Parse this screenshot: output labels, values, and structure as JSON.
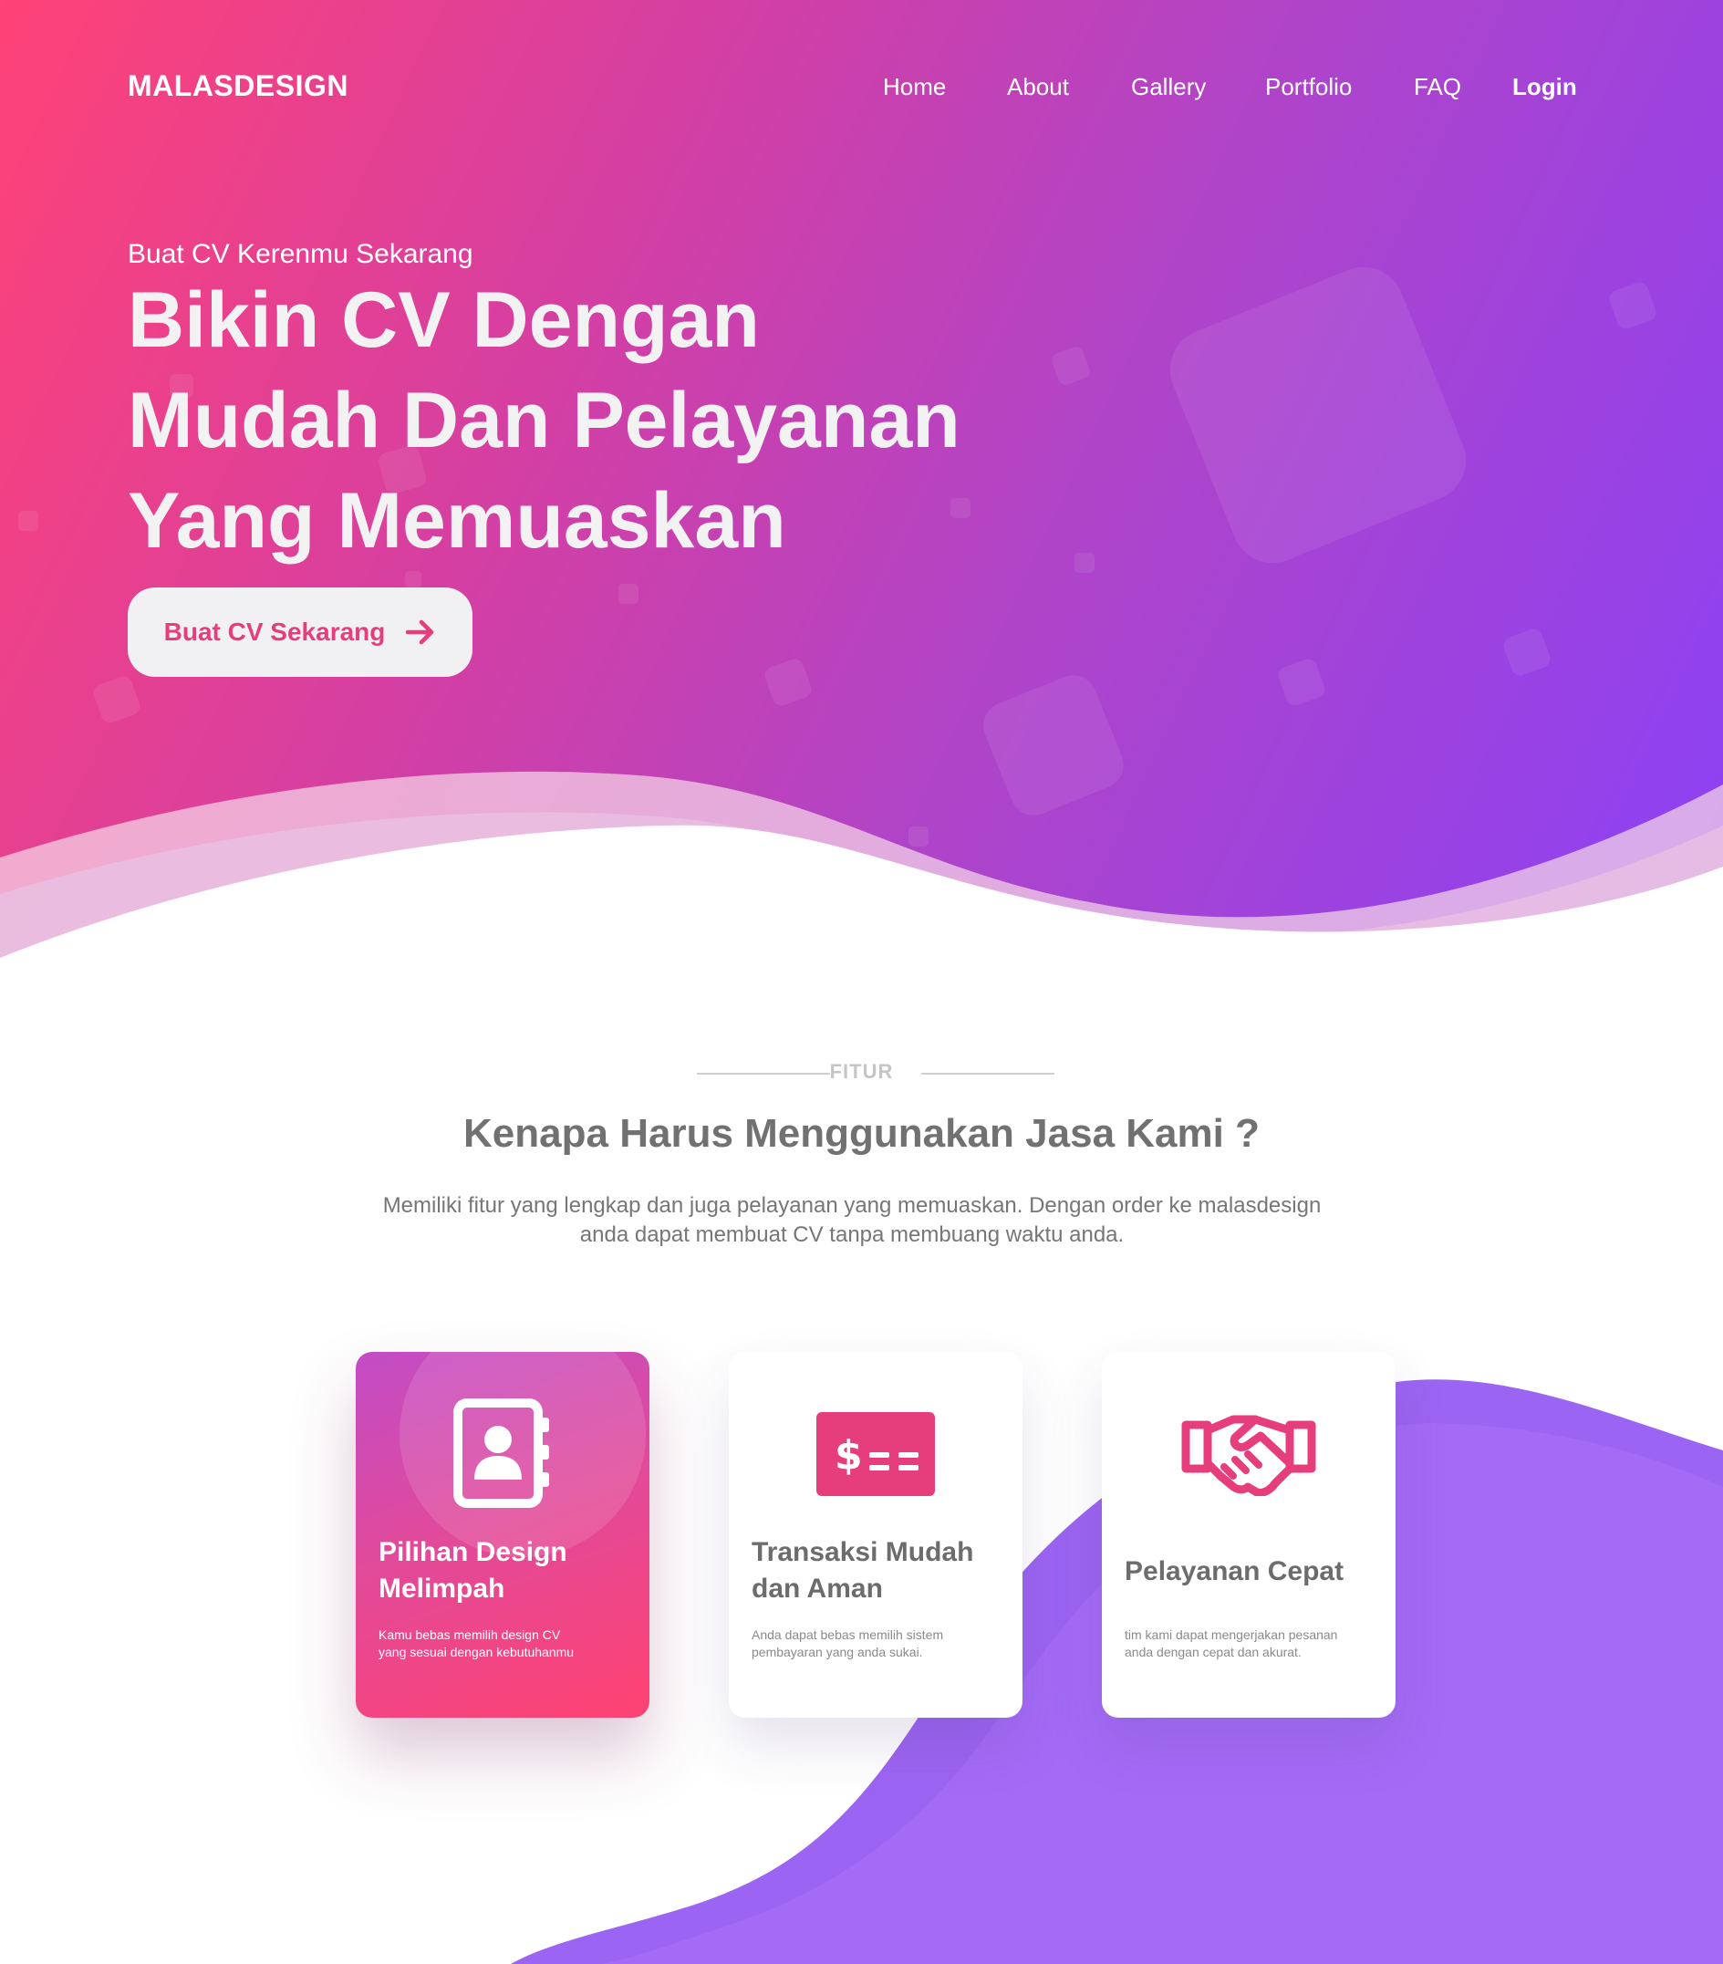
{
  "header": {
    "brand": "MALASDESIGN",
    "nav": [
      "Home",
      "About",
      "Gallery",
      "Portfolio",
      "FAQ"
    ],
    "login": "Login"
  },
  "hero": {
    "kicker": "Buat CV Kerenmu Sekarang",
    "title_line1": "Bikin CV Dengan",
    "title_line2": "Mudah Dan Pelayanan",
    "title_line3": "Yang Memuaskan",
    "cta_label": "Buat CV Sekarang",
    "cta_icon": "arrow-right-icon"
  },
  "features": {
    "eyebrow": "FITUR",
    "title": "Kenapa Harus Menggunakan Jasa Kami ?",
    "desc_line1": "Memiliki fitur yang lengkap dan juga pelayanan yang memuaskan. Dengan order ke malasdesign",
    "desc_line2": "anda dapat membuat CV tanpa membuang waktu anda.",
    "cards": [
      {
        "icon": "contact-book-icon",
        "title_line1": "Pilihan Design",
        "title_line2": "Melimpah",
        "desc_line1": "Kamu bebas memilih design CV",
        "desc_line2": "yang sesuai dengan kebutuhanmu"
      },
      {
        "icon": "payment-card-icon",
        "title_line1": "Transaksi Mudah",
        "title_line2": "dan Aman",
        "desc_line1": "Anda dapat bebas memilih sistem",
        "desc_line2": "pembayaran yang anda sukai."
      },
      {
        "icon": "handshake-icon",
        "title_line1": "Pelayanan Cepat",
        "desc_line1": "tim kami dapat mengerjakan pesanan",
        "desc_line2": "anda dengan cepat dan akurat."
      }
    ]
  },
  "colors": {
    "gradient_start": "#ff4277",
    "gradient_mid": "#c444b8",
    "gradient_end": "#8b41f5",
    "accent": "#e63e7c",
    "blob_purple": "#9c64f2"
  }
}
